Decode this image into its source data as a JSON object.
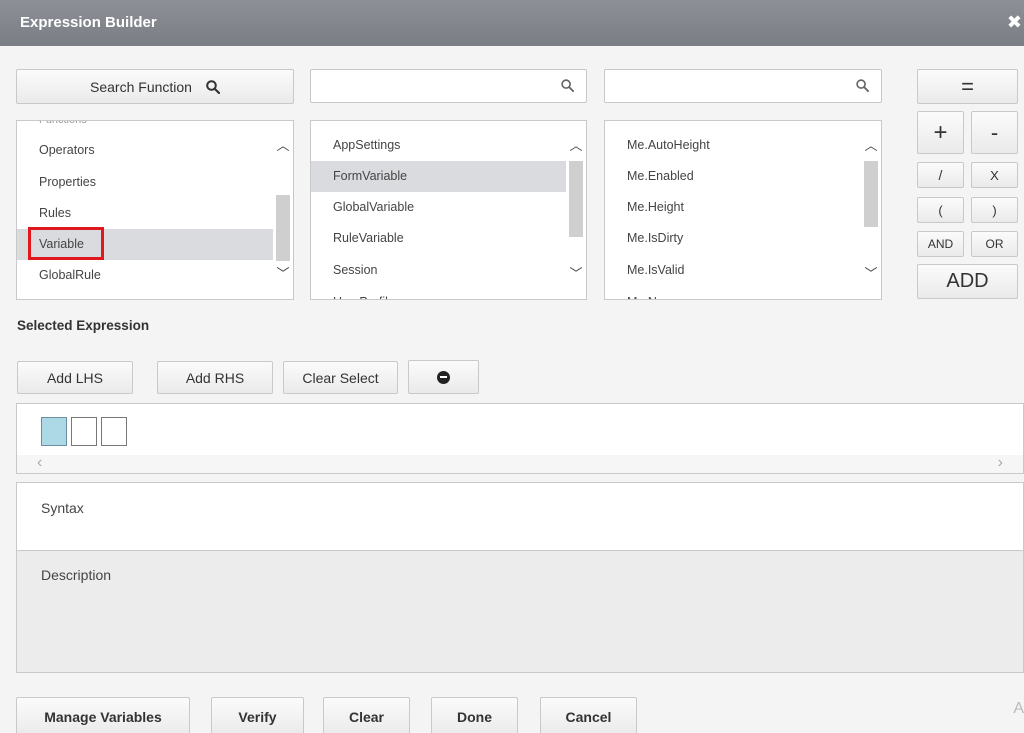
{
  "window": {
    "title": "Expression Builder",
    "close_glyph": "✖"
  },
  "search": {
    "button_label": "Search Function",
    "field2_value": "",
    "field3_value": ""
  },
  "lists": {
    "categories": {
      "partial_top": "Functions",
      "items": [
        "Operators",
        "Properties",
        "Rules",
        "Variable",
        "GlobalRule"
      ],
      "selected": "Variable"
    },
    "variables": {
      "items": [
        "AppSettings",
        "FormVariable",
        "GlobalVariable",
        "RuleVariable",
        "Session"
      ],
      "partial_bottom": "UserProfile",
      "selected": "FormVariable"
    },
    "properties": {
      "items": [
        "Me.AutoHeight",
        "Me.Enabled",
        "Me.Height",
        "Me.IsDirty",
        "Me.IsValid"
      ],
      "partial_bottom": "Me.Name"
    }
  },
  "operators": {
    "equals": "=",
    "plus": "+",
    "minus": "-",
    "divide": "/",
    "multiply": "X",
    "open_paren": "(",
    "close_paren": ")",
    "and": "AND",
    "or": "OR",
    "add": "ADD"
  },
  "selected_expression": {
    "label": "Selected Expression",
    "add_lhs": "Add LHS",
    "add_rhs": "Add RHS",
    "clear_select": "Clear Select",
    "remove_glyph": "−"
  },
  "syntax_label": "Syntax",
  "description_label": "Description",
  "footer": {
    "manage_variables": "Manage Variables",
    "verify": "Verify",
    "clear": "Clear",
    "done": "Done",
    "cancel": "Cancel"
  },
  "edge_char": "A",
  "colors": {
    "titlebar": "#82858c",
    "selection": "#d9dbde",
    "active_slot": "#add8e6",
    "highlight_border": "#e0171c"
  }
}
